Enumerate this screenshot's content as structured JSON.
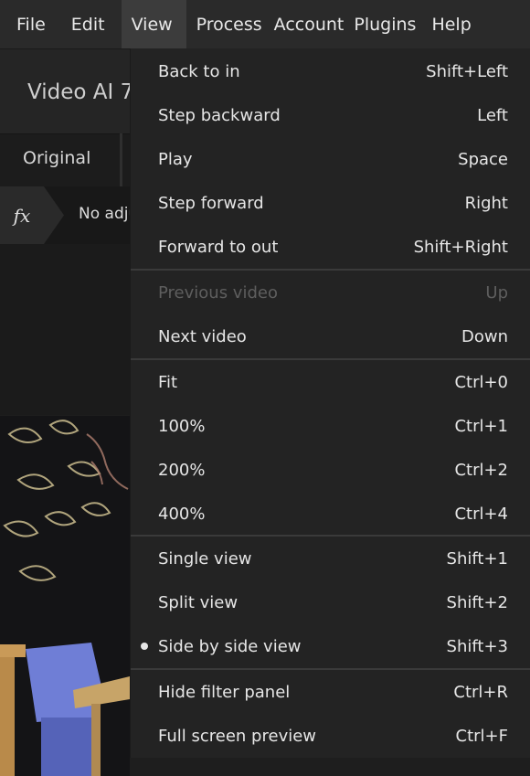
{
  "menubar": {
    "items": [
      {
        "label": "File"
      },
      {
        "label": "Edit"
      },
      {
        "label": "View"
      },
      {
        "label": "Process"
      },
      {
        "label": "Account"
      },
      {
        "label": "Plugins"
      },
      {
        "label": "Help"
      }
    ]
  },
  "app": {
    "title": "Video AI 7",
    "tab_original": "Original",
    "fx_symbol": "fx",
    "filter_status": "No adju"
  },
  "view_menu": {
    "items": [
      {
        "label": "Back to in",
        "shortcut": "Shift+Left"
      },
      {
        "label": "Step backward",
        "shortcut": "Left"
      },
      {
        "label": "Play",
        "shortcut": "Space"
      },
      {
        "label": "Step forward",
        "shortcut": "Right"
      },
      {
        "label": "Forward to out",
        "shortcut": "Shift+Right"
      },
      {
        "label": "Previous video",
        "shortcut": "Up",
        "disabled": true
      },
      {
        "label": "Next video",
        "shortcut": "Down"
      },
      {
        "label": "Fit",
        "shortcut": "Ctrl+0"
      },
      {
        "label": "100%",
        "shortcut": "Ctrl+1"
      },
      {
        "label": "200%",
        "shortcut": "Ctrl+2"
      },
      {
        "label": "400%",
        "shortcut": "Ctrl+4"
      },
      {
        "label": "Single view",
        "shortcut": "Shift+1"
      },
      {
        "label": "Split view",
        "shortcut": "Shift+2"
      },
      {
        "label": "Side by side view",
        "shortcut": "Shift+3",
        "checked": true
      },
      {
        "label": "Hide filter panel",
        "shortcut": "Ctrl+R"
      },
      {
        "label": "Full screen preview",
        "shortcut": "Ctrl+F"
      }
    ]
  },
  "colors": {
    "menubar_bg": "#2a2a2a",
    "menu_bg": "#232323",
    "active_menu": "#3c3c3c",
    "disabled_text": "#5e5e5e",
    "text": "#e6e6e6"
  }
}
